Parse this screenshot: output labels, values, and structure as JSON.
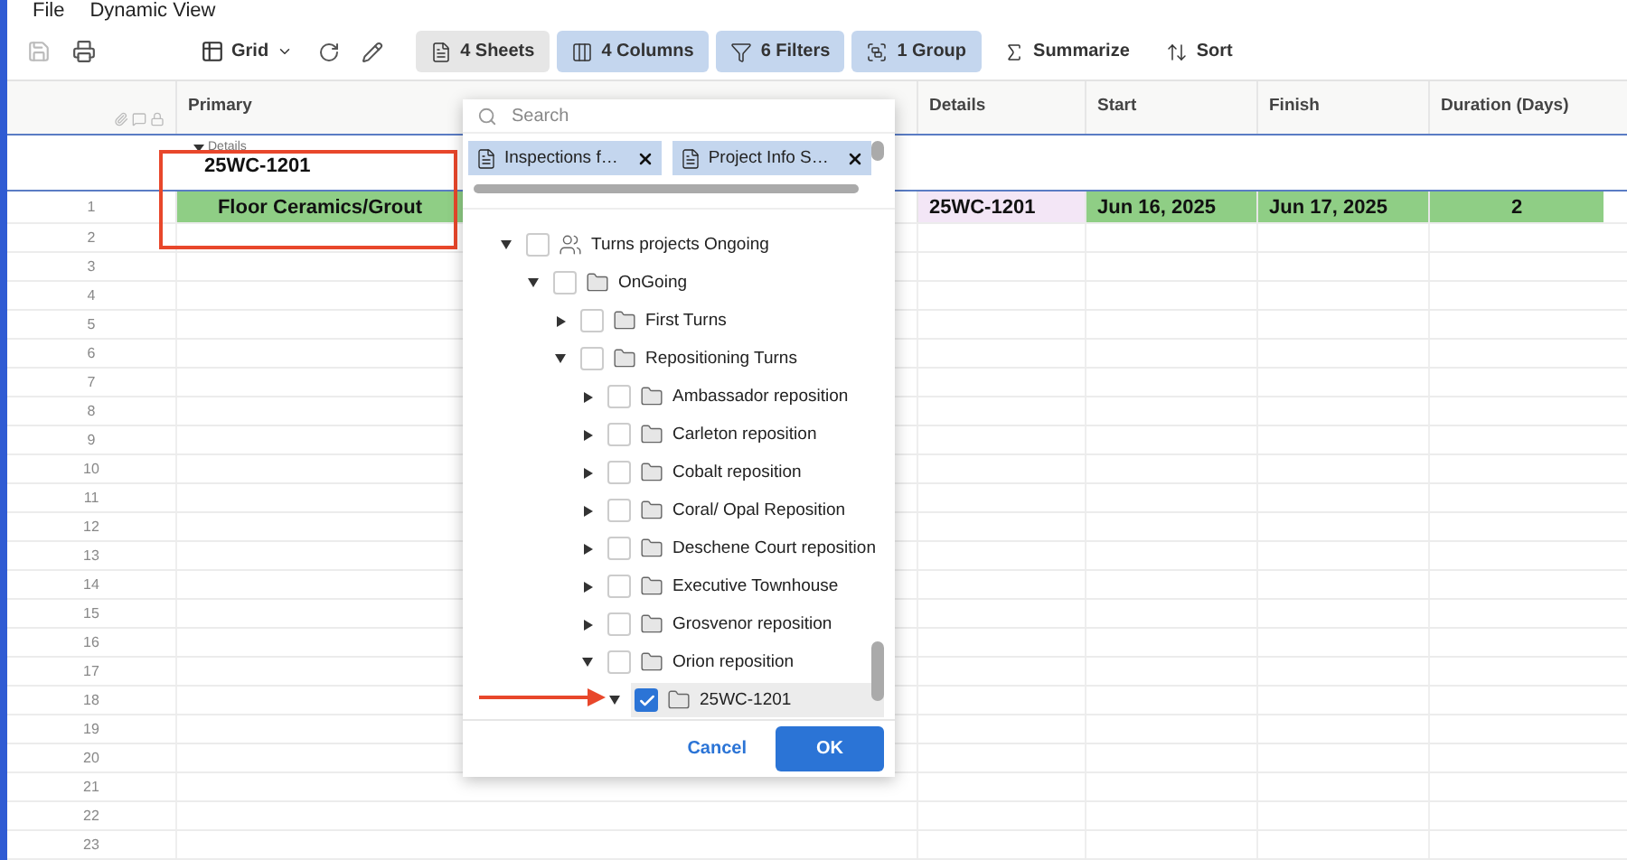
{
  "menu": [
    "File",
    "Dynamic View"
  ],
  "toolbar": {
    "view_label": "Grid",
    "buttons": [
      {
        "label": "4 Sheets",
        "kind": "neutral"
      },
      {
        "label": "4 Columns",
        "kind": "applied"
      },
      {
        "label": "6 Filters",
        "kind": "applied"
      },
      {
        "label": "1 Group",
        "kind": "applied"
      },
      {
        "label": "Summarize",
        "kind": "plain"
      },
      {
        "label": "Sort",
        "kind": "plain"
      }
    ]
  },
  "grid": {
    "columns": [
      "Primary",
      "Details",
      "Start",
      "Finish",
      "Duration (Days)"
    ],
    "group": {
      "label": "Details",
      "expanded": true,
      "value": "25WC-1201"
    },
    "rows": [
      {
        "number": "1",
        "cells": [
          {
            "text": "Floor Ceramics/Grout",
            "color": "#8fce85"
          },
          {
            "text": "25WC-1201",
            "color": "#f3e6f6"
          },
          {
            "text": "Jun 16, 2025",
            "color": "#8fce85"
          },
          {
            "text": "Jun 17, 2025",
            "color": "#8fce85"
          },
          {
            "text": "2",
            "color": "#8fce85"
          }
        ]
      },
      {
        "number": "2"
      },
      {
        "number": "3"
      },
      {
        "number": "4"
      },
      {
        "number": "5"
      },
      {
        "number": "6"
      },
      {
        "number": "7"
      },
      {
        "number": "8"
      },
      {
        "number": "9"
      },
      {
        "number": "10"
      },
      {
        "number": "11"
      },
      {
        "number": "12"
      },
      {
        "number": "13"
      },
      {
        "number": "14"
      },
      {
        "number": "15"
      },
      {
        "number": "16"
      },
      {
        "number": "17"
      },
      {
        "number": "18"
      },
      {
        "number": "19"
      },
      {
        "number": "20"
      },
      {
        "number": "21"
      },
      {
        "number": "22"
      },
      {
        "number": "23"
      }
    ]
  },
  "sheet_picker": {
    "search": {
      "placeholder": "Search"
    },
    "chips": [
      {
        "label": "Inspections f…"
      },
      {
        "label": "Project Info S…"
      }
    ],
    "tree": [
      {
        "label": "Turns projects Ongoing",
        "kind": "group",
        "expanded": true,
        "checked": false,
        "selected": false,
        "children": [
          {
            "label": "OnGoing",
            "kind": "folder",
            "expanded": true,
            "checked": false,
            "selected": false,
            "children": [
              {
                "label": "First Turns",
                "kind": "folder",
                "expanded": false,
                "checked": false,
                "selected": false
              },
              {
                "label": "Repositioning Turns",
                "kind": "folder",
                "expanded": true,
                "checked": false,
                "selected": false,
                "children": [
                  {
                    "label": "Ambassador reposition",
                    "kind": "folder",
                    "expanded": false,
                    "checked": false,
                    "selected": false
                  },
                  {
                    "label": "Carleton reposition",
                    "kind": "folder",
                    "expanded": false,
                    "checked": false,
                    "selected": false
                  },
                  {
                    "label": "Cobalt reposition",
                    "kind": "folder",
                    "expanded": false,
                    "checked": false,
                    "selected": false
                  },
                  {
                    "label": "Coral/ Opal Reposition",
                    "kind": "folder",
                    "expanded": false,
                    "checked": false,
                    "selected": false
                  },
                  {
                    "label": "Deschene Court reposition",
                    "kind": "folder",
                    "expanded": false,
                    "checked": false,
                    "selected": false
                  },
                  {
                    "label": "Executive Townhouse",
                    "kind": "folder",
                    "expanded": false,
                    "checked": false,
                    "selected": false
                  },
                  {
                    "label": "Grosvenor reposition",
                    "kind": "folder",
                    "expanded": false,
                    "checked": false,
                    "selected": false
                  },
                  {
                    "label": "Orion reposition",
                    "kind": "folder",
                    "expanded": true,
                    "checked": false,
                    "selected": false,
                    "children": [
                      {
                        "label": "25WC-1201",
                        "kind": "folder",
                        "expanded": true,
                        "checked": true,
                        "selected": true
                      }
                    ]
                  }
                ]
              }
            ]
          }
        ]
      }
    ],
    "buttons": [
      {
        "label": "Cancel",
        "kind": "link"
      },
      {
        "label": "OK",
        "kind": "primary"
      }
    ]
  }
}
